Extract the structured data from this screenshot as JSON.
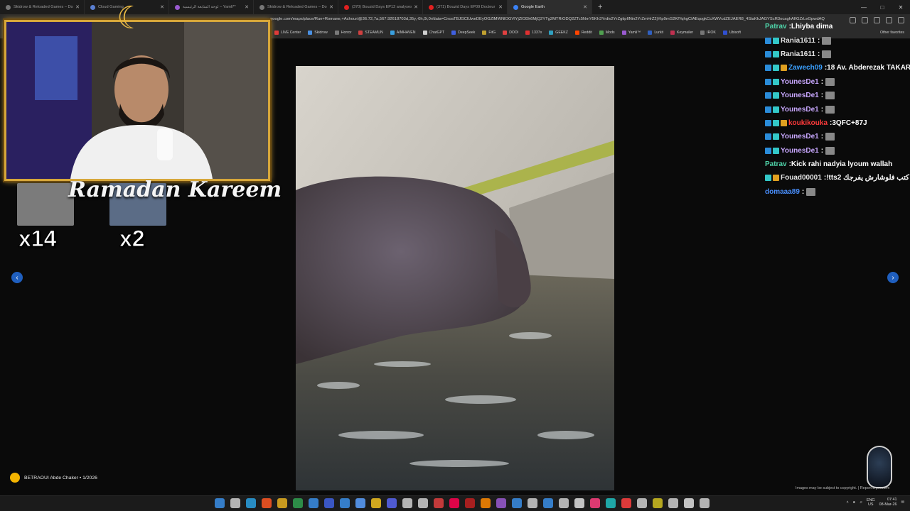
{
  "browser": {
    "tabs": [
      {
        "title": "Skidrow & Reloaded Games – Do…",
        "color": "#777777",
        "active": false
      },
      {
        "title": "Cloud Gaming",
        "color": "#5a7fd1",
        "active": false
      },
      {
        "title": "لوحة المتابعة الرئيسية – Yamli**",
        "color": "#9a5ad1",
        "active": false
      },
      {
        "title": "Skidrow & Reloaded Games – Do…",
        "color": "#777777",
        "active": false
      },
      {
        "title": "(370) Bouzid Days EP12 analyses",
        "color": "#e02020",
        "active": false
      },
      {
        "title": "(371) Bouzid Days EP09 Docteur p",
        "color": "#e02020",
        "active": false
      },
      {
        "title": "Google Earth",
        "color": "#3b82f6",
        "active": true
      }
    ],
    "new_tab": "+",
    "url": "google.com/maps/place/Rue+Romane,+Achour/@36.72,7a,567.92618703d,35y,-0h,0t,0r/data=CnoaTBJGClUweDEyOGZlMWNlOGVlYjZlODk6MjQ2YTg2MTRiODQ2ZTc5NmY5Kh3Yrdiv2YrZgtipIINin2YrZmHrZ2jYtp9mG2KfYqhgCIAEqogkCcXWVcdZEJAER8_4StaKkJAGYScR3ocaghAIfGZrLeGpwdAQgIlAToDCgEw",
    "bookmarks": [
      {
        "label": "LIVE Center",
        "color": "#e03a3a"
      },
      {
        "label": "Skidrow",
        "color": "#4a90e2"
      },
      {
        "label": "Horror",
        "color": "#7a7a7a"
      },
      {
        "label": "STEAMUN",
        "color": "#d04040"
      },
      {
        "label": "AIMHAVEN",
        "color": "#3aa0e0"
      },
      {
        "label": "ChatGPT",
        "color": "#cfcfcf"
      },
      {
        "label": "DeepSeek",
        "color": "#4060e0"
      },
      {
        "label": "FitG",
        "color": "#c0a030"
      },
      {
        "label": "DODI",
        "color": "#e04040"
      },
      {
        "label": "1337x",
        "color": "#e03030"
      },
      {
        "label": "GEEKZ",
        "color": "#30a0c0"
      },
      {
        "label": "Reddit",
        "color": "#ff4500"
      },
      {
        "label": "Mods",
        "color": "#50a050"
      },
      {
        "label": "Yamli™",
        "color": "#9a5ad1"
      },
      {
        "label": "Lurkit",
        "color": "#3060c0"
      },
      {
        "label": "Keymailer",
        "color": "#c03050"
      },
      {
        "label": "IROK",
        "color": "#777777"
      },
      {
        "label": "Ubisoft",
        "color": "#3050d0"
      }
    ],
    "other_favorites": "Other favorites"
  },
  "viewer": {
    "credit": "BETRAOUI Abde Chaker • 1/2026",
    "disclaimer": "Images may be subject to copyright. | Report a problem"
  },
  "overlay": {
    "greeting": "Ramadan Kareem",
    "gift_counts": [
      "x14",
      "x2"
    ]
  },
  "chat": {
    "messages": [
      {
        "user": "Patrav",
        "user_color": "#4fd2a8",
        "text": "Lhiyba dima",
        "badges": [],
        "emote": false
      },
      {
        "user": "Rania1611",
        "user_color": "#e6e6e6",
        "text": "",
        "badges": [
          "b1",
          "b2"
        ],
        "emote": true
      },
      {
        "user": "Rania1611",
        "user_color": "#e6e6e6",
        "text": "",
        "badges": [
          "b1",
          "b2"
        ],
        "emote": true
      },
      {
        "user": "Zawech09",
        "user_color": "#3aa0ff",
        "text": "18 Av. Abderezak TAKAR",
        "badges": [
          "b1",
          "b2",
          "b3"
        ],
        "emote": false
      },
      {
        "user": "YounesDe1",
        "user_color": "#c9a8ff",
        "text": "",
        "badges": [
          "b1",
          "b2"
        ],
        "emote": true
      },
      {
        "user": "YounesDe1",
        "user_color": "#c9a8ff",
        "text": "",
        "badges": [
          "b1",
          "b2"
        ],
        "emote": true
      },
      {
        "user": "YounesDe1",
        "user_color": "#c9a8ff",
        "text": "",
        "badges": [
          "b1",
          "b2"
        ],
        "emote": true
      },
      {
        "user": "koukikouka",
        "user_color": "#ff3b3b",
        "text": "3QFC+87J",
        "badges": [
          "b1",
          "b2",
          "b3"
        ],
        "emote": false
      },
      {
        "user": "YounesDe1",
        "user_color": "#c9a8ff",
        "text": "",
        "badges": [
          "b1",
          "b2"
        ],
        "emote": true
      },
      {
        "user": "YounesDe1",
        "user_color": "#c9a8ff",
        "text": "",
        "badges": [
          "b1",
          "b2"
        ],
        "emote": true
      },
      {
        "user": "Patrav",
        "user_color": "#4fd2a8",
        "text": "Kick rahi nadyia lyoum wallah",
        "badges": [],
        "emote": false
      },
      {
        "user": "Fouad00001",
        "user_color": "#e6e6e6",
        "text": "!tts2 كتب فلوشارش يفرجك",
        "badges": [
          "b2",
          "b3"
        ],
        "emote": false
      },
      {
        "user": "domaaa89",
        "user_color": "#4a90ff",
        "text": "",
        "badges": [],
        "emote": true
      }
    ]
  },
  "taskbar": {
    "language": "ENG",
    "region": "US",
    "time": "07:41",
    "date": "08-Mar-26"
  }
}
